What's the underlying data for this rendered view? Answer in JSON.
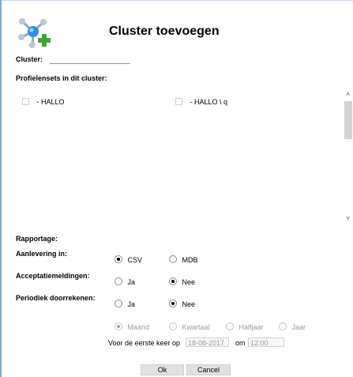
{
  "dialog": {
    "title": "Cluster toevoegen",
    "logo_icon": "cluster-add-icon",
    "accent_color": "#3aa635"
  },
  "cluster": {
    "label": "Cluster:",
    "value": ""
  },
  "profielensets": {
    "label": "Profielensets in dit cluster:",
    "items": [
      {
        "label": "- HALLO",
        "checked": false
      },
      {
        "label": "- HALLO \\ q",
        "checked": false
      }
    ]
  },
  "rapportage": {
    "heading": "Rapportage:",
    "aanlevering": {
      "label": "Aanlevering in:",
      "options": [
        "CSV",
        "MDB"
      ],
      "selected": "CSV"
    },
    "acceptatie": {
      "label": "Acceptatiemeldingen:",
      "options": [
        "Ja",
        "Nee"
      ],
      "selected": "Nee"
    },
    "periodiek": {
      "label": "Periodiek doorrekenen:",
      "options": [
        "Ja",
        "Nee"
      ],
      "selected": "Nee"
    },
    "frequency": {
      "options": [
        "Maand",
        "Kwartaal",
        "Halfjaar",
        "Jaar"
      ],
      "selected": "Maand",
      "enabled": false
    },
    "first_time": {
      "prefix": "Voor de eerste keer op",
      "date": "18-08-2017",
      "at_label": "om",
      "time": "12:00"
    }
  },
  "buttons": {
    "ok": "Ok",
    "cancel": "Cancel"
  }
}
